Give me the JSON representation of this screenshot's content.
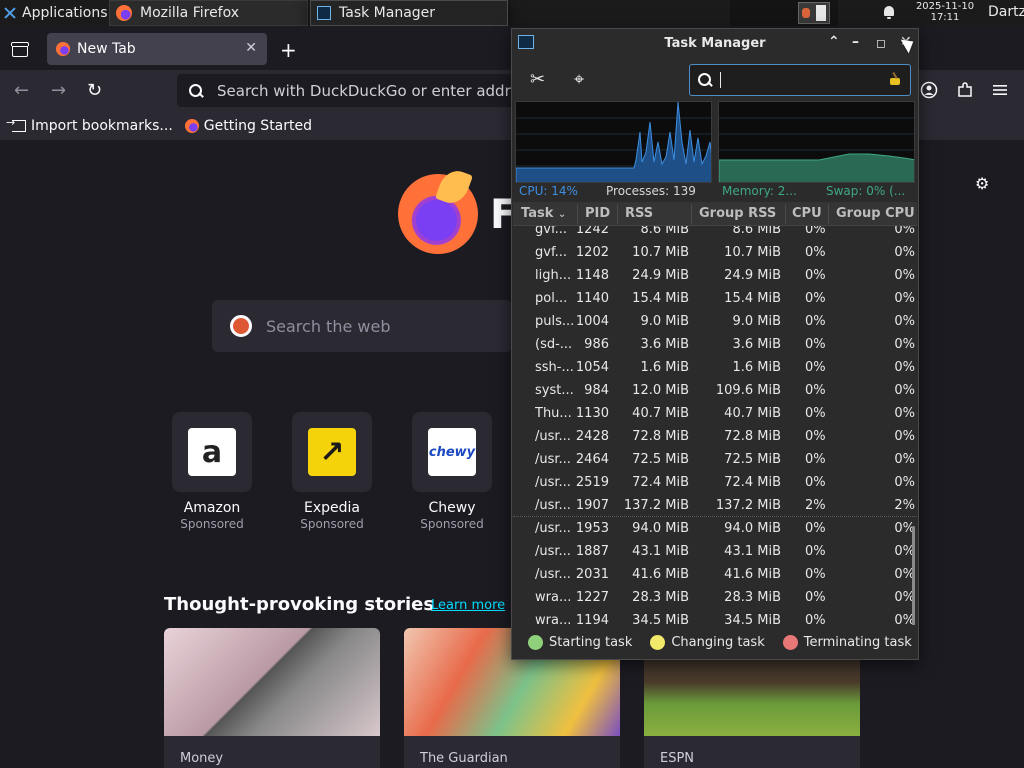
{
  "panel": {
    "applications_label": "Applications",
    "taskbar": [
      {
        "label": "Mozilla Firefox",
        "active": true
      },
      {
        "label": "Task Manager",
        "active": false
      }
    ],
    "clock_date": "2025-11-10",
    "clock_time": "17:11",
    "user": "Dartz"
  },
  "firefox": {
    "tab_title": "New Tab",
    "urlbar_placeholder": "Search with DuckDuckGo or enter address",
    "bookmarks": [
      "Import bookmarks...",
      "Getting Started"
    ],
    "logo_word": "F",
    "web_search_placeholder": "Search the web",
    "shortcuts": [
      {
        "name": "Amazon",
        "label": "Sponsored",
        "logo_text": "a",
        "logo_bg": "#ffffff",
        "logo_color": "#222222"
      },
      {
        "name": "Expedia",
        "label": "Sponsored",
        "logo_text": "↗",
        "logo_bg": "#f5d30a",
        "logo_color": "#1a1a1a"
      },
      {
        "name": "Chewy",
        "label": "Sponsored",
        "logo_text": "chewy",
        "logo_bg": "#ffffff",
        "logo_color": "#1c49c2"
      }
    ],
    "stories_title": "Thought-provoking stories",
    "stories_link": "Learn more",
    "stories": [
      {
        "source": "Money"
      },
      {
        "source": "The Guardian"
      },
      {
        "source": "ESPN"
      }
    ]
  },
  "task_manager": {
    "title": "Task Manager",
    "search_value": "",
    "stats": {
      "cpu": "CPU: 14%",
      "processes": "Processes: 139",
      "memory": "Memory: 2...",
      "swap": "Swap: 0% (..."
    },
    "columns": [
      "Task",
      "PID",
      "RSS",
      "Group RSS",
      "CPU",
      "Group CPU"
    ],
    "rows": [
      {
        "task": "gvf...",
        "pid": "1242",
        "rss": "8.6 MiB",
        "group_rss": "8.6 MiB",
        "cpu": "0%",
        "group_cpu": "0%"
      },
      {
        "task": "gvf...",
        "pid": "1202",
        "rss": "10.7 MiB",
        "group_rss": "10.7 MiB",
        "cpu": "0%",
        "group_cpu": "0%"
      },
      {
        "task": "ligh...",
        "pid": "1148",
        "rss": "24.9 MiB",
        "group_rss": "24.9 MiB",
        "cpu": "0%",
        "group_cpu": "0%"
      },
      {
        "task": "pol...",
        "pid": "1140",
        "rss": "15.4 MiB",
        "group_rss": "15.4 MiB",
        "cpu": "0%",
        "group_cpu": "0%"
      },
      {
        "task": "puls...",
        "pid": "1004",
        "rss": "9.0 MiB",
        "group_rss": "9.0 MiB",
        "cpu": "0%",
        "group_cpu": "0%"
      },
      {
        "task": "(sd-...",
        "pid": "986",
        "rss": "3.6 MiB",
        "group_rss": "3.6 MiB",
        "cpu": "0%",
        "group_cpu": "0%"
      },
      {
        "task": "ssh-...",
        "pid": "1054",
        "rss": "1.6 MiB",
        "group_rss": "1.6 MiB",
        "cpu": "0%",
        "group_cpu": "0%"
      },
      {
        "task": "syst...",
        "pid": "984",
        "rss": "12.0 MiB",
        "group_rss": "109.6 MiB",
        "cpu": "0%",
        "group_cpu": "0%"
      },
      {
        "task": "Thu...",
        "pid": "1130",
        "rss": "40.7 MiB",
        "group_rss": "40.7 MiB",
        "cpu": "0%",
        "group_cpu": "0%"
      },
      {
        "task": "/usr...",
        "pid": "2428",
        "rss": "72.8 MiB",
        "group_rss": "72.8 MiB",
        "cpu": "0%",
        "group_cpu": "0%"
      },
      {
        "task": "/usr...",
        "pid": "2464",
        "rss": "72.5 MiB",
        "group_rss": "72.5 MiB",
        "cpu": "0%",
        "group_cpu": "0%"
      },
      {
        "task": "/usr...",
        "pid": "2519",
        "rss": "72.4 MiB",
        "group_rss": "72.4 MiB",
        "cpu": "0%",
        "group_cpu": "0%"
      },
      {
        "task": "/usr...",
        "pid": "1907",
        "rss": "137.2 MiB",
        "group_rss": "137.2 MiB",
        "cpu": "2%",
        "group_cpu": "2%"
      },
      {
        "task": "/usr...",
        "pid": "1953",
        "rss": "94.0 MiB",
        "group_rss": "94.0 MiB",
        "cpu": "0%",
        "group_cpu": "0%"
      },
      {
        "task": "/usr...",
        "pid": "1887",
        "rss": "43.1 MiB",
        "group_rss": "43.1 MiB",
        "cpu": "0%",
        "group_cpu": "0%"
      },
      {
        "task": "/usr...",
        "pid": "2031",
        "rss": "41.6 MiB",
        "group_rss": "41.6 MiB",
        "cpu": "0%",
        "group_cpu": "0%"
      },
      {
        "task": "wra...",
        "pid": "1227",
        "rss": "28.3 MiB",
        "group_rss": "28.3 MiB",
        "cpu": "0%",
        "group_cpu": "0%"
      },
      {
        "task": "wra...",
        "pid": "1194",
        "rss": "34.5 MiB",
        "group_rss": "34.5 MiB",
        "cpu": "0%",
        "group_cpu": "0%"
      }
    ],
    "legend": [
      {
        "label": "Starting task",
        "color": "#8fd07a"
      },
      {
        "label": "Changing task",
        "color": "#f2e86a"
      },
      {
        "label": "Terminating task",
        "color": "#e87878"
      }
    ],
    "colors": {
      "cpu_graph": "#3d8ee0",
      "memory_graph": "#3ea884"
    }
  }
}
